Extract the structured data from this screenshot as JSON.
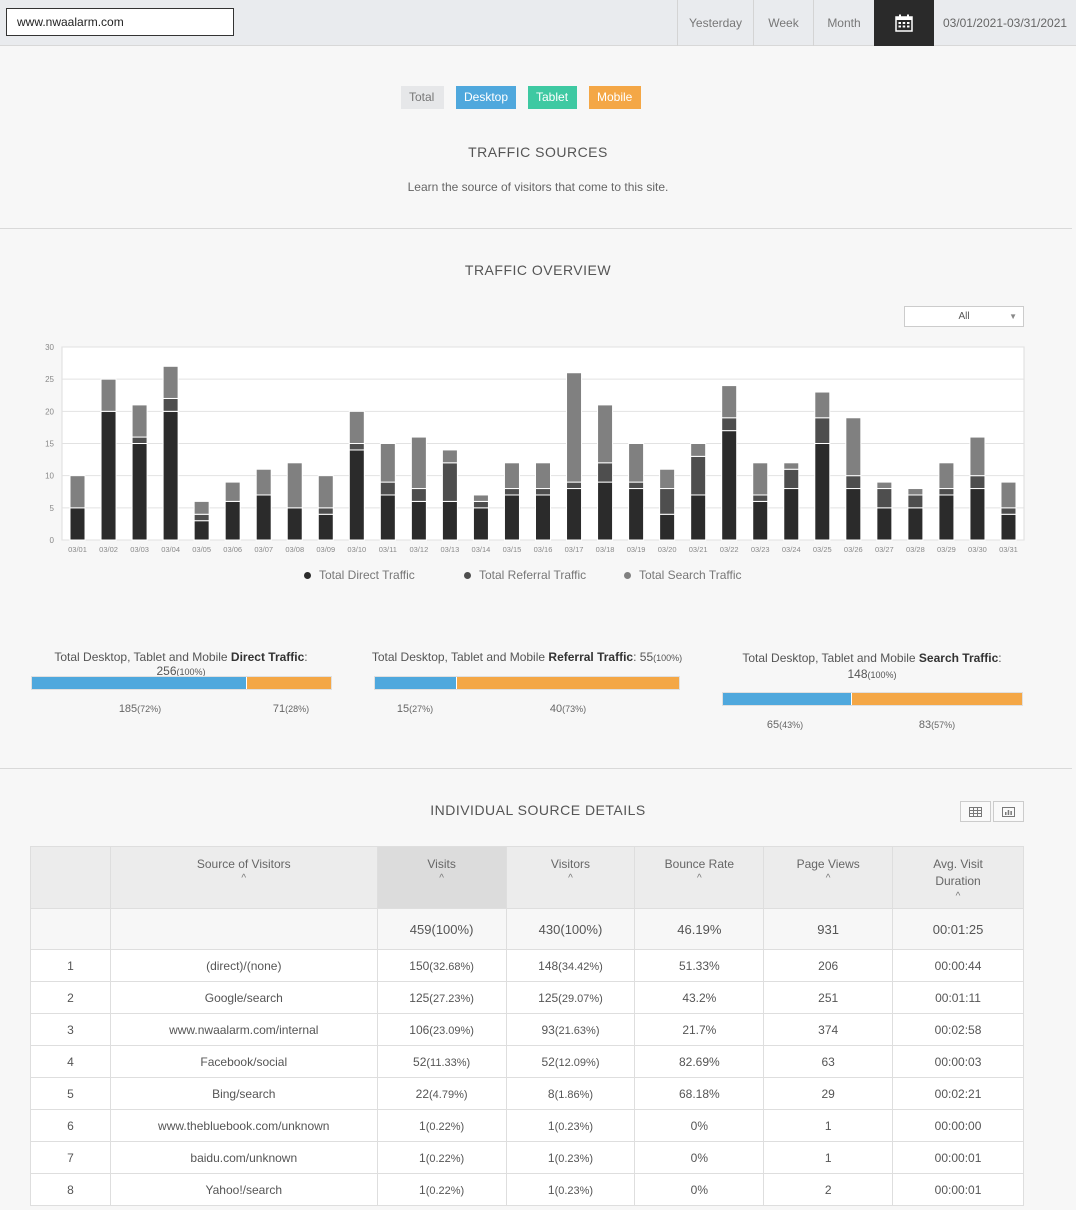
{
  "topbar": {
    "site": "www.nwaalarm.com",
    "ranges": [
      "Yesterday",
      "Week",
      "Month"
    ],
    "calendar_icon": "calendar-icon",
    "date_range": "03/01/2021-03/31/2021"
  },
  "device_tabs": {
    "total": "Total",
    "desktop": "Desktop",
    "tablet": "Tablet",
    "mobile": "Mobile"
  },
  "colors": {
    "desktop": "#4fa8dd",
    "tablet": "#3ec9a2",
    "mobile": "#f4a746",
    "direct": "#2b2b2b",
    "referral": "#4e4e4e",
    "search": "#808080"
  },
  "sources_header": {
    "title": "TRAFFIC SOURCES",
    "subtitle": "Learn the source of visitors that come to this site."
  },
  "overview": {
    "title": "TRAFFIC OVERVIEW",
    "filter": "All"
  },
  "chart_data": {
    "type": "bar",
    "stacked": true,
    "categories": [
      "03/01",
      "03/02",
      "03/03",
      "03/04",
      "03/05",
      "03/06",
      "03/07",
      "03/08",
      "03/09",
      "03/10",
      "03/11",
      "03/12",
      "03/13",
      "03/14",
      "03/15",
      "03/16",
      "03/17",
      "03/18",
      "03/19",
      "03/20",
      "03/21",
      "03/22",
      "03/23",
      "03/24",
      "03/25",
      "03/26",
      "03/27",
      "03/28",
      "03/29",
      "03/30",
      "03/31"
    ],
    "series": [
      {
        "name": "Total Direct Traffic",
        "values": [
          5,
          20,
          15,
          20,
          3,
          6,
          7,
          5,
          4,
          14,
          7,
          6,
          6,
          5,
          7,
          7,
          8,
          9,
          8,
          4,
          7,
          17,
          6,
          8,
          15,
          8,
          5,
          5,
          7,
          8,
          4
        ]
      },
      {
        "name": "Total Referral Traffic",
        "values": [
          0,
          0,
          1,
          2,
          1,
          0,
          0,
          0,
          1,
          1,
          2,
          2,
          6,
          1,
          1,
          1,
          1,
          3,
          1,
          4,
          6,
          2,
          1,
          3,
          4,
          2,
          3,
          2,
          1,
          2,
          1
        ]
      },
      {
        "name": "Total Search Traffic",
        "values": [
          5,
          5,
          5,
          5,
          2,
          3,
          4,
          7,
          5,
          5,
          6,
          8,
          2,
          1,
          4,
          4,
          17,
          9,
          6,
          3,
          2,
          5,
          5,
          1,
          4,
          9,
          1,
          1,
          4,
          6,
          4
        ]
      }
    ],
    "yticks": [
      0,
      5,
      10,
      15,
      20,
      25,
      30
    ],
    "ylim": [
      0,
      30
    ],
    "grid": true,
    "legend": "bottom"
  },
  "totals": [
    {
      "prefix": "Total Desktop, Tablet and Mobile ",
      "kind": "Direct Traffic",
      "value": ": 256",
      "pct": "(100%)",
      "desktop": "185",
      "desktop_pct": "(72%)",
      "mobile": "71",
      "mobile_pct": "(28%)",
      "desktop_share": 72
    },
    {
      "prefix": "Total Desktop, Tablet and Mobile ",
      "kind": "Referral Traffic",
      "value": ": 55",
      "pct": "(100%)",
      "desktop": "15",
      "desktop_pct": "(27%)",
      "mobile": "40",
      "mobile_pct": "(73%)",
      "desktop_share": 27
    },
    {
      "prefix": "Total Desktop, Tablet and Mobile ",
      "kind": "Search Traffic",
      "value": ":",
      "value2": "148",
      "pct": "(100%)",
      "desktop": "65",
      "desktop_pct": "(43%)",
      "mobile": "83",
      "mobile_pct": "(57%)",
      "desktop_share": 43
    }
  ],
  "details": {
    "title": "INDIVIDUAL SOURCE DETAILS",
    "table_icon": "table-view-icon",
    "chart_icon": "chart-view-icon",
    "columns": [
      "",
      "Source of Visitors",
      "Visits",
      "Visitors",
      "Bounce Rate",
      "Page Views",
      "Avg. Visit Duration"
    ],
    "sort_glyph": "^",
    "summary": {
      "visits": "459",
      "visits_pct": "(100%)",
      "visitors": "430",
      "visitors_pct": "(100%)",
      "bounce": "46.19%",
      "views": "931",
      "duration": "00:01:25"
    },
    "rows": [
      {
        "n": "1",
        "source": "(direct)/(none)",
        "visits": "150",
        "visits_pct": "(32.68%)",
        "visitors": "148",
        "visitors_pct": "(34.42%)",
        "bounce": "51.33%",
        "views": "206",
        "duration": "00:00:44"
      },
      {
        "n": "2",
        "source": "Google/search",
        "visits": "125",
        "visits_pct": "(27.23%)",
        "visitors": "125",
        "visitors_pct": "(29.07%)",
        "bounce": "43.2%",
        "views": "251",
        "duration": "00:01:11"
      },
      {
        "n": "3",
        "source": "www.nwaalarm.com/internal",
        "visits": "106",
        "visits_pct": "(23.09%)",
        "visitors": "93",
        "visitors_pct": "(21.63%)",
        "bounce": "21.7%",
        "views": "374",
        "duration": "00:02:58"
      },
      {
        "n": "4",
        "source": "Facebook/social",
        "visits": "52",
        "visits_pct": "(11.33%)",
        "visitors": "52",
        "visitors_pct": "(12.09%)",
        "bounce": "82.69%",
        "views": "63",
        "duration": "00:00:03"
      },
      {
        "n": "5",
        "source": "Bing/search",
        "visits": "22",
        "visits_pct": "(4.79%)",
        "visitors": "8",
        "visitors_pct": "(1.86%)",
        "bounce": "68.18%",
        "views": "29",
        "duration": "00:02:21"
      },
      {
        "n": "6",
        "source": "www.thebluebook.com/unknown",
        "visits": "1",
        "visits_pct": "(0.22%)",
        "visitors": "1",
        "visitors_pct": "(0.23%)",
        "bounce": "0%",
        "views": "1",
        "duration": "00:00:00"
      },
      {
        "n": "7",
        "source": "baidu.com/unknown",
        "visits": "1",
        "visits_pct": "(0.22%)",
        "visitors": "1",
        "visitors_pct": "(0.23%)",
        "bounce": "0%",
        "views": "1",
        "duration": "00:00:01"
      },
      {
        "n": "8",
        "source": "Yahoo!/search",
        "visits": "1",
        "visits_pct": "(0.22%)",
        "visitors": "1",
        "visitors_pct": "(0.23%)",
        "bounce": "0%",
        "views": "2",
        "duration": "00:00:01"
      }
    ]
  }
}
